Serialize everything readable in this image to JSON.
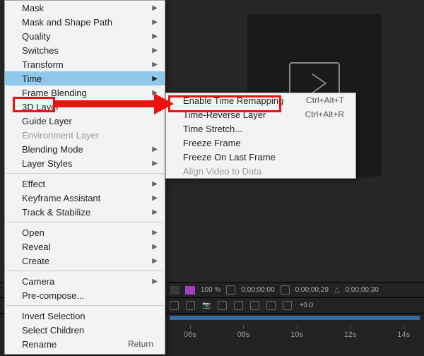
{
  "placeholder": {
    "label_suffix": "tion"
  },
  "menu1": {
    "mask": "Mask",
    "mask_shape": "Mask and Shape Path",
    "quality": "Quality",
    "switches": "Switches",
    "transform": "Transform",
    "time": "Time",
    "frame_blending": "Frame Blending",
    "threed": "3D Layer",
    "guide": "Guide Layer",
    "env": "Environment Layer",
    "blending": "Blending Mode",
    "styles": "Layer Styles",
    "effect": "Effect",
    "keyframe": "Keyframe Assistant",
    "track": "Track & Stabilize",
    "open": "Open",
    "reveal": "Reveal",
    "create": "Create",
    "camera": "Camera",
    "precompose": "Pre-compose...",
    "invert": "Invert Selection",
    "select_children": "Select Children",
    "rename": "Rename",
    "rename_sc": "Return"
  },
  "menu2": {
    "enable": "Enable Time Remapping",
    "enable_sc": "Ctrl+Alt+T",
    "reverse": "Time-Reverse Layer",
    "reverse_sc": "Ctrl+Alt+R",
    "stretch": "Time Stretch...",
    "freeze": "Freeze Frame",
    "freeze_last": "Freeze On Last Frame",
    "align": "Align Video to Data"
  },
  "timeline": {
    "zoom": "100 %",
    "time1": "0;00;00;00",
    "time2": "0;00;00;29",
    "time3": "0;00;00;30",
    "exposure": "+0.0",
    "ticks": [
      "06s",
      "08s",
      "10s",
      "12s",
      "14s"
    ]
  }
}
